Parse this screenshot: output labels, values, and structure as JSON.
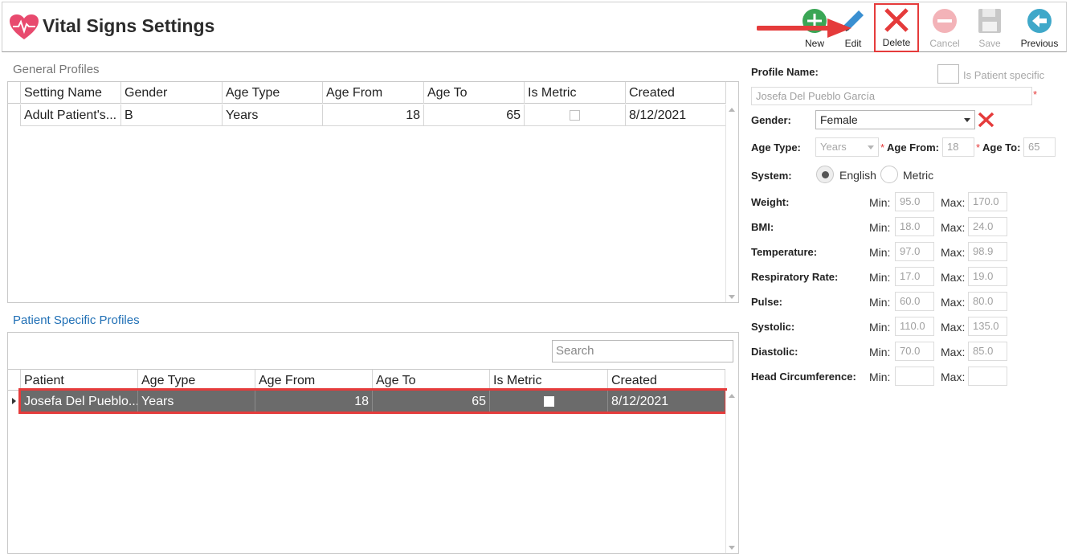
{
  "app": {
    "title": "Vital Signs Settings"
  },
  "toolbar": {
    "new": "New",
    "edit": "Edit",
    "delete": "Delete",
    "cancel": "Cancel",
    "save": "Save",
    "previous": "Previous"
  },
  "general": {
    "title": "General Profiles",
    "columns": [
      "Setting Name",
      "Gender",
      "Age Type",
      "Age From",
      "Age To",
      "Is Metric",
      "Created"
    ],
    "rows": [
      {
        "name": "Adult Patient's...",
        "gender": "B",
        "age_type": "Years",
        "age_from": "18",
        "age_to": "65",
        "is_metric": false,
        "created": "8/12/2021"
      }
    ]
  },
  "patient": {
    "title": "Patient Specific Profiles",
    "search_placeholder": "Search",
    "columns": [
      "Patient",
      "Age Type",
      "Age From",
      "Age To",
      "Is Metric",
      "Created"
    ],
    "rows": [
      {
        "patient": "Josefa Del Pueblo...",
        "age_type": "Years",
        "age_from": "18",
        "age_to": "65",
        "is_metric": false,
        "created": "8/12/2021"
      }
    ]
  },
  "form": {
    "profile_name_label": "Profile Name:",
    "is_patient_specific_label": "Is Patient specific",
    "profile_name_value": "Josefa Del Pueblo García",
    "required_mark": "*",
    "gender_label": "Gender:",
    "gender_value": "Female",
    "age_type_label": "Age Type:",
    "age_type_value": "Years",
    "age_from_label": "Age From:",
    "age_from_value": "18",
    "age_to_label": "Age To:",
    "age_to_value": "65",
    "system_label": "System:",
    "system_english": "English",
    "system_metric": "Metric",
    "system_selected": "English",
    "min_label": "Min:",
    "max_label": "Max:",
    "vitals": [
      {
        "label": "Weight:",
        "min": "95.0",
        "max": "170.0"
      },
      {
        "label": "BMI:",
        "min": "18.0",
        "max": "24.0"
      },
      {
        "label": "Temperature:",
        "min": "97.0",
        "max": "98.9"
      },
      {
        "label": "Respiratory Rate:",
        "min": "17.0",
        "max": "19.0"
      },
      {
        "label": "Pulse:",
        "min": "60.0",
        "max": "80.0"
      },
      {
        "label": "Systolic:",
        "min": "110.0",
        "max": "135.0"
      },
      {
        "label": "Diastolic:",
        "min": "70.0",
        "max": "85.0"
      },
      {
        "label": "Head Circumference:",
        "min": "",
        "max": ""
      }
    ]
  },
  "colors": {
    "accent_red": "#e53b3b",
    "selected_row": "#6b6b6b",
    "link_blue": "#1f6fb5",
    "new_green": "#3aa655",
    "previous_teal": "#3fa8c9"
  },
  "icons": {
    "logo": "heart-pulse-icon",
    "new": "plus-circle-icon",
    "edit": "pencil-icon",
    "delete": "x-icon",
    "cancel": "minus-circle-icon",
    "save": "floppy-disk-icon",
    "previous": "arrow-left-circle-icon"
  }
}
